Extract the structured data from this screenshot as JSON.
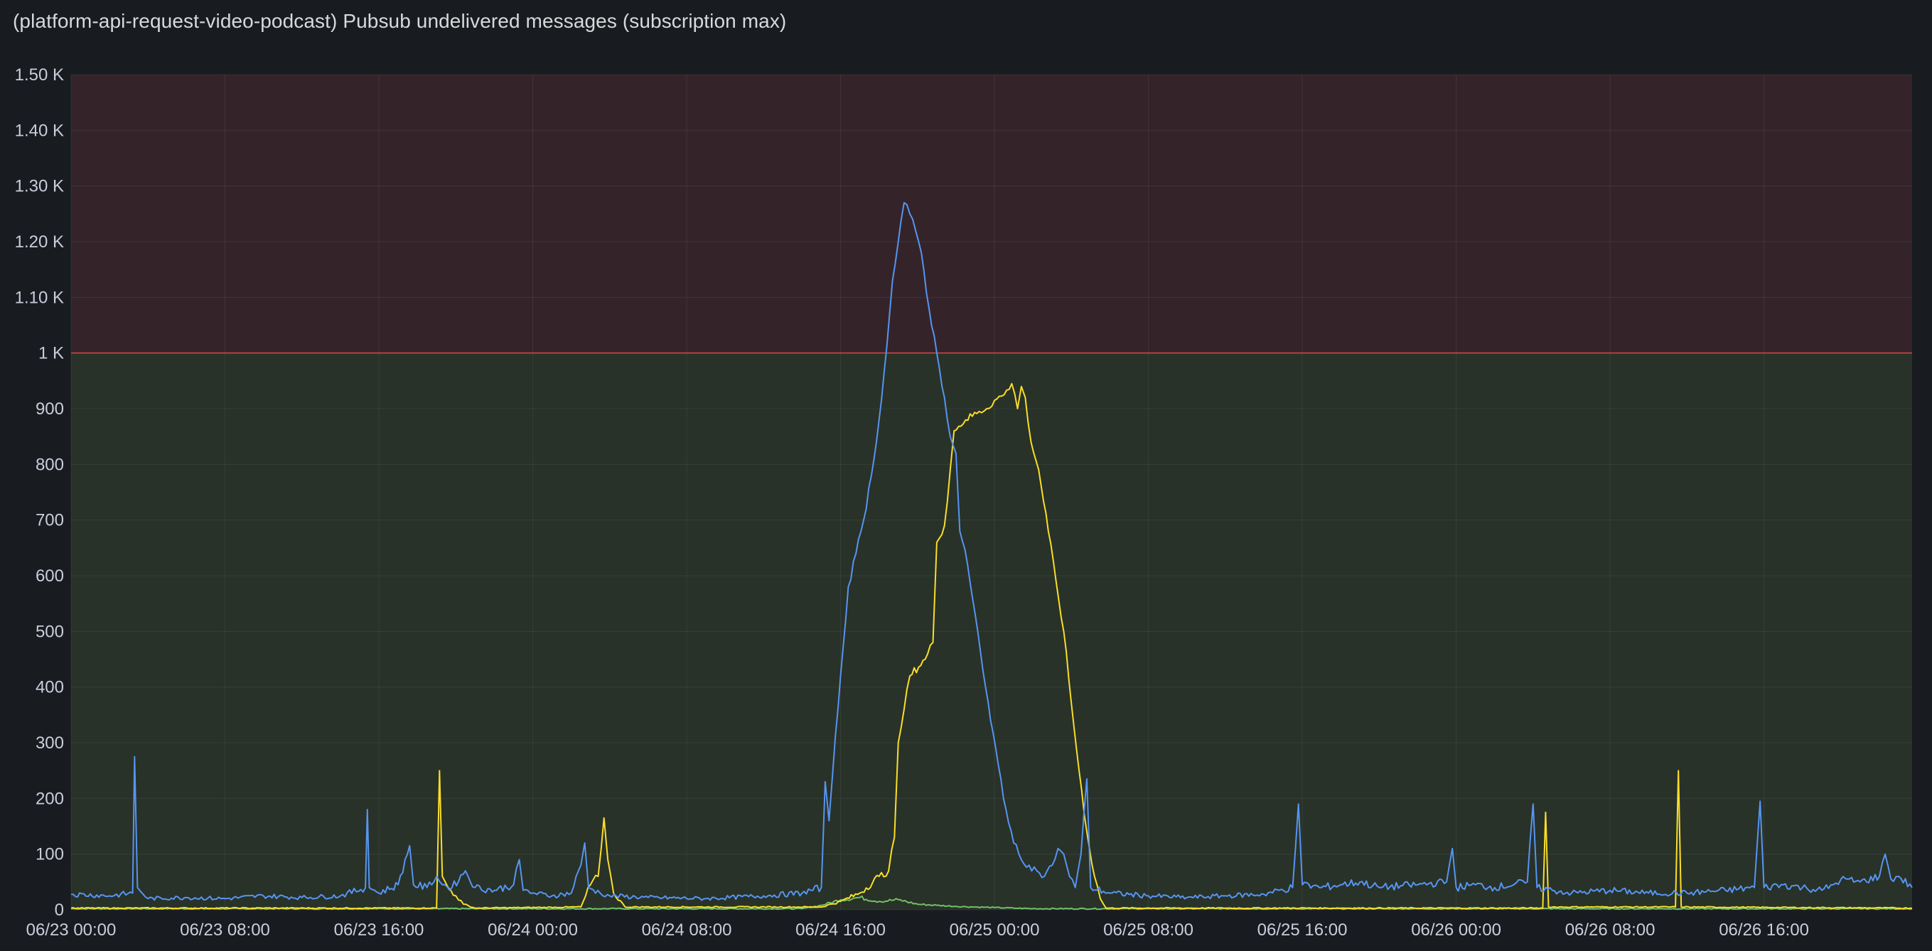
{
  "panel": {
    "title": "(platform-api-request-video-podcast) Pubsub undelivered messages (subscription max)"
  },
  "chart_data": {
    "type": "line",
    "xlabel": "",
    "ylabel": "",
    "ylim": [
      0,
      1500
    ],
    "x_range": [
      "06/23 00:00",
      "06/26 23:40"
    ],
    "grid": true,
    "legend": "none",
    "threshold": {
      "value": 1000,
      "below_color": "#283228",
      "above_color": "#34242a",
      "line_color": "#d44a4a"
    },
    "y_ticks": [
      {
        "value": 0,
        "label": "0"
      },
      {
        "value": 100,
        "label": "100"
      },
      {
        "value": 200,
        "label": "200"
      },
      {
        "value": 300,
        "label": "300"
      },
      {
        "value": 400,
        "label": "400"
      },
      {
        "value": 500,
        "label": "500"
      },
      {
        "value": 600,
        "label": "600"
      },
      {
        "value": 700,
        "label": "700"
      },
      {
        "value": 800,
        "label": "800"
      },
      {
        "value": 900,
        "label": "900"
      },
      {
        "value": 1000,
        "label": "1 K"
      },
      {
        "value": 1100,
        "label": "1.10 K"
      },
      {
        "value": 1200,
        "label": "1.20 K"
      },
      {
        "value": 1300,
        "label": "1.30 K"
      },
      {
        "value": 1400,
        "label": "1.40 K"
      },
      {
        "value": 1500,
        "label": "1.50 K"
      }
    ],
    "x_ticks": [
      {
        "hours": 0,
        "label": "06/23 00:00"
      },
      {
        "hours": 8,
        "label": "06/23 08:00"
      },
      {
        "hours": 16,
        "label": "06/23 16:00"
      },
      {
        "hours": 24,
        "label": "06/24 00:00"
      },
      {
        "hours": 32,
        "label": "06/24 08:00"
      },
      {
        "hours": 40,
        "label": "06/24 16:00"
      },
      {
        "hours": 48,
        "label": "06/25 00:00"
      },
      {
        "hours": 56,
        "label": "06/25 08:00"
      },
      {
        "hours": 64,
        "label": "06/25 16:00"
      },
      {
        "hours": 72,
        "label": "06/26 00:00"
      },
      {
        "hours": 80,
        "label": "06/26 08:00"
      },
      {
        "hours": 88,
        "label": "06/26 16:00"
      }
    ],
    "series": [
      {
        "color": "#73bf69",
        "points": [
          [
            0,
            2
          ],
          [
            38,
            2
          ],
          [
            39,
            8
          ],
          [
            40,
            18
          ],
          [
            41,
            22
          ],
          [
            42,
            15
          ],
          [
            43,
            18
          ],
          [
            44,
            10
          ],
          [
            45,
            8
          ],
          [
            46,
            6
          ],
          [
            47,
            5
          ],
          [
            48,
            4
          ],
          [
            49,
            3
          ],
          [
            50,
            2
          ],
          [
            95.7,
            2
          ]
        ]
      },
      {
        "color": "#fade2a",
        "points": [
          [
            0,
            3
          ],
          [
            19.0,
            3
          ],
          [
            19.15,
            250
          ],
          [
            19.3,
            60
          ],
          [
            19.6,
            40
          ],
          [
            20.0,
            25
          ],
          [
            20.4,
            10
          ],
          [
            21,
            3
          ],
          [
            26.5,
            5
          ],
          [
            27.0,
            45
          ],
          [
            27.4,
            60
          ],
          [
            27.7,
            165
          ],
          [
            27.9,
            90
          ],
          [
            28.2,
            30
          ],
          [
            28.8,
            5
          ],
          [
            39,
            5
          ],
          [
            40,
            15
          ],
          [
            41,
            30
          ],
          [
            42,
            60
          ],
          [
            42.5,
            70
          ],
          [
            42.8,
            130
          ],
          [
            43.0,
            300
          ],
          [
            43.3,
            360
          ],
          [
            43.6,
            420
          ],
          [
            44.4,
            450
          ],
          [
            44.8,
            480
          ],
          [
            45.0,
            660
          ],
          [
            45.4,
            690
          ],
          [
            45.7,
            790
          ],
          [
            45.9,
            860
          ],
          [
            46.5,
            880
          ],
          [
            47.2,
            895
          ],
          [
            47.6,
            900
          ],
          [
            48.0,
            915
          ],
          [
            48.5,
            925
          ],
          [
            48.9,
            945
          ],
          [
            49.2,
            900
          ],
          [
            49.4,
            940
          ],
          [
            49.6,
            920
          ],
          [
            49.9,
            840
          ],
          [
            50.3,
            790
          ],
          [
            50.8,
            680
          ],
          [
            51.2,
            590
          ],
          [
            51.6,
            500
          ],
          [
            52.0,
            370
          ],
          [
            52.4,
            250
          ],
          [
            52.8,
            140
          ],
          [
            53.2,
            60
          ],
          [
            53.5,
            20
          ],
          [
            53.8,
            3
          ],
          [
            76.5,
            3
          ],
          [
            76.65,
            175
          ],
          [
            76.8,
            5
          ],
          [
            83.4,
            5
          ],
          [
            83.55,
            250
          ],
          [
            83.7,
            5
          ],
          [
            95.7,
            3
          ]
        ]
      },
      {
        "color": "#5794f2",
        "points": [
          [
            0,
            28
          ],
          [
            2,
            25
          ],
          [
            3.2,
            30
          ],
          [
            3.3,
            275
          ],
          [
            3.45,
            40
          ],
          [
            4,
            20
          ],
          [
            6,
            22
          ],
          [
            8,
            20
          ],
          [
            10,
            25
          ],
          [
            12,
            22
          ],
          [
            14,
            25
          ],
          [
            15.3,
            40
          ],
          [
            15.4,
            180
          ],
          [
            15.5,
            40
          ],
          [
            16,
            30
          ],
          [
            17,
            45
          ],
          [
            17.6,
            115
          ],
          [
            17.8,
            45
          ],
          [
            18.5,
            40
          ],
          [
            19,
            60
          ],
          [
            19.3,
            45
          ],
          [
            19.8,
            40
          ],
          [
            20.5,
            70
          ],
          [
            21,
            40
          ],
          [
            22,
            35
          ],
          [
            23,
            45
          ],
          [
            23.3,
            90
          ],
          [
            23.5,
            35
          ],
          [
            24,
            30
          ],
          [
            25,
            25
          ],
          [
            26,
            30
          ],
          [
            26.5,
            80
          ],
          [
            26.7,
            120
          ],
          [
            26.9,
            40
          ],
          [
            27.5,
            30
          ],
          [
            28,
            25
          ],
          [
            30,
            22
          ],
          [
            33,
            20
          ],
          [
            36,
            25
          ],
          [
            38,
            30
          ],
          [
            39,
            40
          ],
          [
            39.2,
            230
          ],
          [
            39.4,
            160
          ],
          [
            39.6,
            250
          ],
          [
            40,
            420
          ],
          [
            40.4,
            580
          ],
          [
            40.8,
            640
          ],
          [
            41.2,
            700
          ],
          [
            41.6,
            780
          ],
          [
            42.0,
            880
          ],
          [
            42.4,
            1010
          ],
          [
            42.7,
            1130
          ],
          [
            43.0,
            1200
          ],
          [
            43.3,
            1270
          ],
          [
            43.6,
            1250
          ],
          [
            43.9,
            1220
          ],
          [
            44.2,
            1180
          ],
          [
            44.6,
            1080
          ],
          [
            45.0,
            1000
          ],
          [
            45.4,
            920
          ],
          [
            45.7,
            850
          ],
          [
            46.0,
            820
          ],
          [
            46.2,
            680
          ],
          [
            46.6,
            620
          ],
          [
            47.0,
            530
          ],
          [
            47.4,
            430
          ],
          [
            47.8,
            340
          ],
          [
            48.2,
            260
          ],
          [
            48.6,
            180
          ],
          [
            49.0,
            120
          ],
          [
            49.4,
            90
          ],
          [
            49.8,
            80
          ],
          [
            50.2,
            70
          ],
          [
            50.6,
            60
          ],
          [
            51.0,
            80
          ],
          [
            51.3,
            110
          ],
          [
            51.6,
            100
          ],
          [
            51.9,
            60
          ],
          [
            52.2,
            40
          ],
          [
            52.5,
            100
          ],
          [
            52.8,
            235
          ],
          [
            53.0,
            40
          ],
          [
            54,
            30
          ],
          [
            56,
            25
          ],
          [
            58,
            22
          ],
          [
            60,
            25
          ],
          [
            62,
            28
          ],
          [
            63.5,
            40
          ],
          [
            63.8,
            190
          ],
          [
            64.0,
            45
          ],
          [
            65,
            40
          ],
          [
            66,
            45
          ],
          [
            67,
            50
          ],
          [
            68,
            40
          ],
          [
            70,
            45
          ],
          [
            71.5,
            50
          ],
          [
            71.8,
            110
          ],
          [
            72.0,
            40
          ],
          [
            73,
            45
          ],
          [
            74,
            40
          ],
          [
            75.7,
            50
          ],
          [
            76.0,
            190
          ],
          [
            76.2,
            40
          ],
          [
            77,
            35
          ],
          [
            78,
            30
          ],
          [
            80,
            35
          ],
          [
            82,
            30
          ],
          [
            84,
            30
          ],
          [
            86,
            35
          ],
          [
            87.5,
            40
          ],
          [
            87.8,
            195
          ],
          [
            88.0,
            40
          ],
          [
            89,
            45
          ],
          [
            90,
            40
          ],
          [
            91,
            35
          ],
          [
            91.6,
            45
          ],
          [
            92,
            55
          ],
          [
            93,
            50
          ],
          [
            94,
            60
          ],
          [
            94.3,
            100
          ],
          [
            94.6,
            55
          ],
          [
            95,
            60
          ],
          [
            95.7,
            40
          ]
        ]
      }
    ]
  }
}
